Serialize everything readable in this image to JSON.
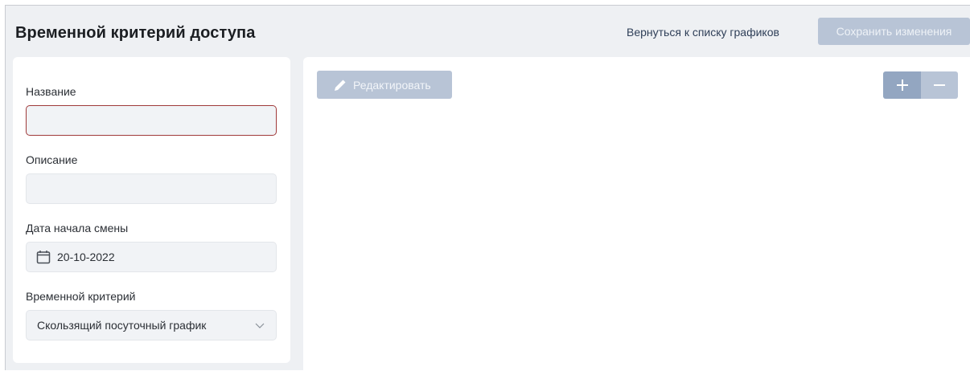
{
  "header": {
    "title": "Временной критерий доступа",
    "back_link": "Вернуться к списку графиков",
    "save_label": "Сохранить изменения"
  },
  "form": {
    "name_label": "Название",
    "name_value": "",
    "description_label": "Описание",
    "description_value": "",
    "start_date_label": "Дата начала смены",
    "start_date_value": "20-10-2022",
    "criterion_label": "Временной критерий",
    "criterion_value": "Скользящий посуточный график"
  },
  "toolbar": {
    "edit_label": "Редактировать",
    "zoom_in": "+",
    "zoom_out": "−"
  },
  "icons": {
    "edit": "pencil-icon",
    "date": "calendar-icon",
    "select": "chevron-down-icon"
  },
  "colors": {
    "background": "#eef0f3",
    "button_disabled": "#b8c4d6",
    "button_active": "#93a6c1",
    "error_border": "#a03a3a"
  }
}
